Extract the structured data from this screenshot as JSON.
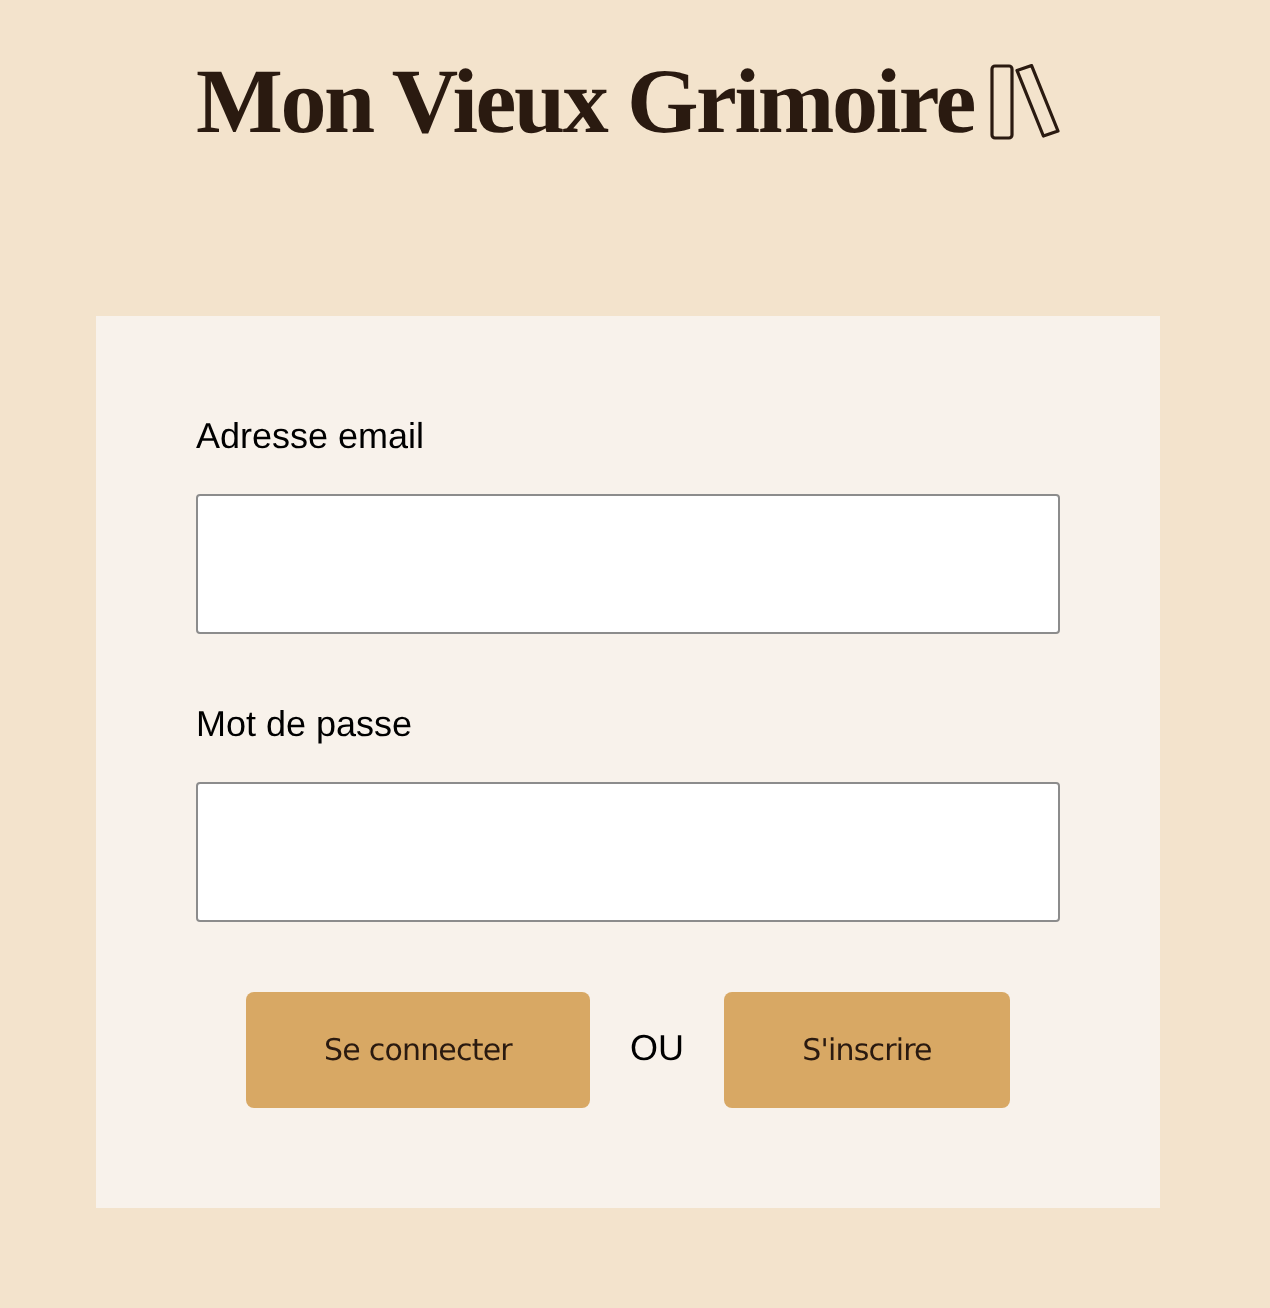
{
  "header": {
    "title": "Mon Vieux Grimoire"
  },
  "form": {
    "fields": [
      {
        "label": "Adresse email"
      },
      {
        "label": "Mot de passe"
      }
    ],
    "actions": [
      {
        "kind": "button",
        "label": "Se connecter"
      },
      {
        "kind": "text",
        "label": "OU"
      },
      {
        "kind": "button",
        "label": "S'inscrire"
      }
    ]
  }
}
